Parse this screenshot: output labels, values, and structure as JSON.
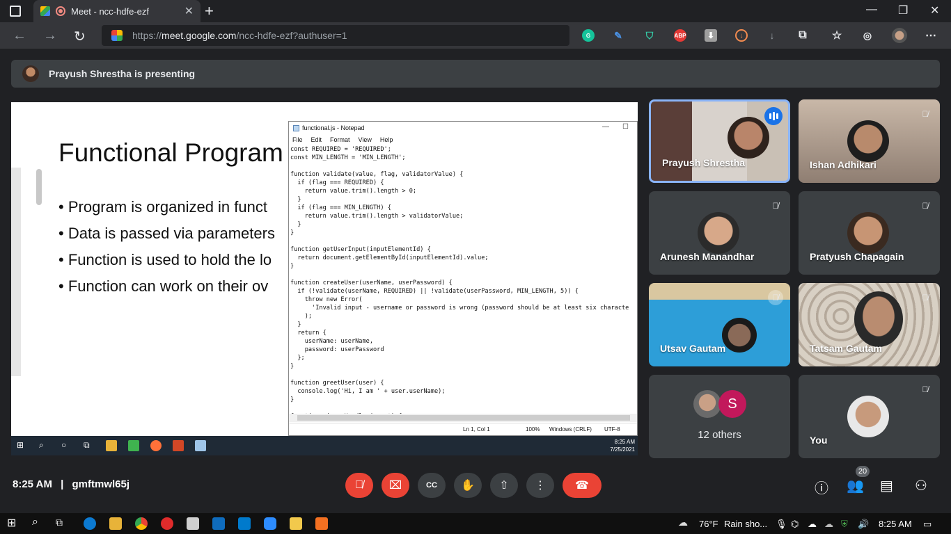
{
  "browser": {
    "tab_title": "Meet - ncc-hdfe-ezf",
    "url_prefix": "https://",
    "url_host": "meet.google.com",
    "url_path": "/ncc-hdfe-ezf?authuser=1",
    "ext_abp": "ABP"
  },
  "banner": {
    "text": "Prayush Shrestha is presenting"
  },
  "slide": {
    "title": "Functional Program",
    "bullets": [
      "Program is organized in funct",
      "Data is passed via parameters",
      "Function is used to hold the lo",
      "Function can work on their ov"
    ]
  },
  "notepad": {
    "title": "functional.js - Notepad",
    "menu": [
      "File",
      "Edit",
      "Format",
      "View",
      "Help"
    ],
    "code": "const REQUIRED = 'REQUIRED';\nconst MIN_LENGTH = 'MIN_LENGTH';\n\nfunction validate(value, flag, validatorValue) {\n  if (flag === REQUIRED) {\n    return value.trim().length > 0;\n  }\n  if (flag === MIN_LENGTH) {\n    return value.trim().length > validatorValue;\n  }\n}\n\nfunction getUserInput(inputElementId) {\n  return document.getElementById(inputElementId).value;\n}\n\nfunction createUser(userName, userPassword) {\n  if (!validate(userName, REQUIRED) || !validate(userPassword, MIN_LENGTH, 5)) {\n    throw new Error(\n      'Invalid input - username or password is wrong (password should be at least six characte\n    );\n  }\n  return {\n    userName: userName,\n    password: userPassword\n  };\n}\n\nfunction greetUser(user) {\n  console.log('Hi, I am ' + user.userName);\n}\n\nfunction signupHandler(event) {",
    "status": {
      "position": "Ln 1, Col 1",
      "zoom": "100%",
      "line_ending": "Windows (CRLF)",
      "encoding": "UTF-8"
    }
  },
  "remote_taskbar": {
    "time": "8:25 AM",
    "date": "7/25/2021"
  },
  "participants": [
    {
      "name": "Prayush Shrestha"
    },
    {
      "name": "Ishan Adhikari"
    },
    {
      "name": "Arunesh Manandhar"
    },
    {
      "name": "Pratyush Chapagain"
    },
    {
      "name": "Utsav Gautam"
    },
    {
      "name": "Tatsam Gautam"
    },
    {
      "name": "12 others",
      "avatar_letter": "S"
    },
    {
      "name": "You"
    }
  ],
  "meeting": {
    "time": "8:25 AM",
    "separator": "|",
    "code": "gmftmwl65j",
    "participant_count": "20"
  },
  "taskbar": {
    "weather": "76°F",
    "weather_text": "Rain sho...",
    "time": "8:25 AM"
  },
  "colors": {
    "accent": "#8ab4f8",
    "danger": "#ea4335",
    "surface": "#3c4043",
    "background": "#202124"
  }
}
